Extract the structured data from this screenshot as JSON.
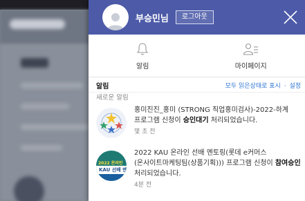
{
  "header": {
    "username": "부승민님",
    "logout_label": "로그아웃",
    "accent_color": "#4c5aa8"
  },
  "quick_menu": [
    {
      "label": "알림",
      "icon": "bell-icon"
    },
    {
      "label": "마이페이지",
      "icon": "user-list-icon"
    }
  ],
  "alerts": {
    "title": "알림",
    "mark_all_read": "모두 읽은상태로 표시",
    "separator": "·",
    "settings": "설정",
    "new_section_label": "새로운 알림"
  },
  "notifications": [
    {
      "text_before": "홍미진진_홍미 (STRONG 직업홍미검사)-2022-하계 프로그램 신청이 ",
      "text_strong": "승인대기",
      "text_after": " 처리되었습니다.",
      "time": "몇 초 전",
      "thumb_icon": "stars-badge-icon"
    },
    {
      "text_before": "2022 KAU 온라인 선배 멘토링(롯데 e커머스(온사이트마케팅팀(상품기획))) 프로그램 신청이 ",
      "text_strong": "참여승인",
      "text_after": " 처리되었습니다.",
      "time": "4분 전",
      "thumb_icon": "mentoring-badge-icon",
      "thumb_text_top": "2022 온라인",
      "thumb_text_mid": "KAU 선배 멘"
    }
  ]
}
